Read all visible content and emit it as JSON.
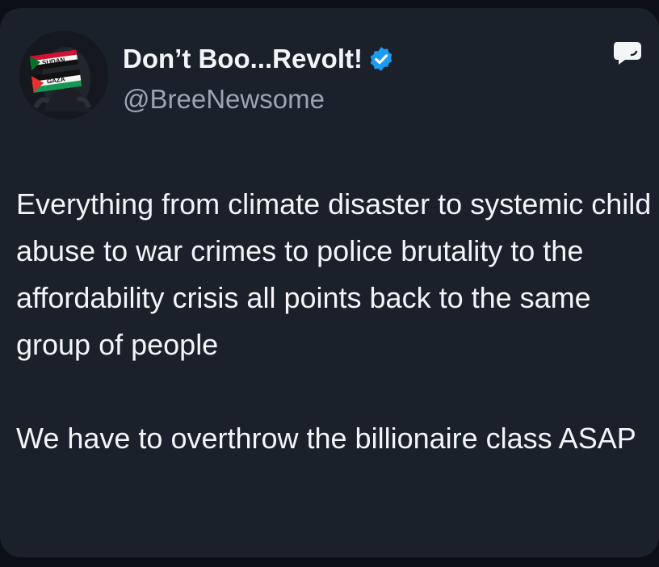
{
  "tweet": {
    "author": {
      "display_name": "Don’t Boo...Revolt!",
      "handle": "@BreeNewsome",
      "verified": true,
      "verified_icon": "verified-badge-icon",
      "avatar_flag_labels": [
        "SUDAN",
        "GAZA"
      ]
    },
    "top_right_icon": "speech-bubble-icon",
    "paragraphs": [
      "Everything from climate disaster to systemic child abuse to war crimes to police brutality to the affordability crisis all points back to the same group of people",
      "We have to overthrow the billionaire class ASAP"
    ]
  },
  "colors": {
    "background": "#1a212b",
    "text_primary": "#f3f5f7",
    "text_secondary": "#9aa5b1",
    "verified_blue": "#1d9bf0"
  }
}
